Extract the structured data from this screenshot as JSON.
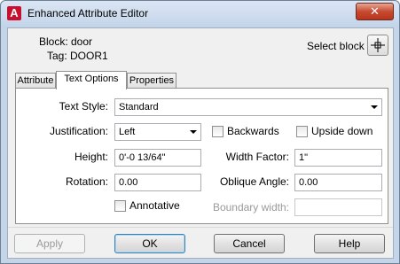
{
  "window": {
    "title": "Enhanced Attribute Editor",
    "app_icon_letter": "A",
    "close_glyph": "✕",
    "accent_color": "#c8102e"
  },
  "header": {
    "block": "Block: door",
    "tag": "Tag: DOOR1",
    "select_block_label": "Select block",
    "select_block_icon": "crosshair-pick-icon"
  },
  "tabs": [
    {
      "label": "Attribute",
      "active": false
    },
    {
      "label": "Text Options",
      "active": true
    },
    {
      "label": "Properties",
      "active": false
    }
  ],
  "form": {
    "text_style": {
      "label": "Text Style:",
      "value": "Standard"
    },
    "justification": {
      "label": "Justification:",
      "value": "Left"
    },
    "backwards": {
      "label": "Backwards",
      "checked": false
    },
    "upside_down": {
      "label": "Upside down",
      "checked": false
    },
    "height": {
      "label": "Height:",
      "value": "0'-0 13/64\""
    },
    "width_factor": {
      "label": "Width Factor:",
      "value": "1\""
    },
    "rotation": {
      "label": "Rotation:",
      "value": "0.00"
    },
    "oblique_angle": {
      "label": "Oblique Angle:",
      "value": "0.00"
    },
    "annotative": {
      "label": "Annotative",
      "checked": false
    },
    "boundary_width": {
      "label": "Boundary width:",
      "value": "",
      "enabled": false
    }
  },
  "buttons": {
    "apply": "Apply",
    "ok": "OK",
    "cancel": "Cancel",
    "help": "Help"
  }
}
